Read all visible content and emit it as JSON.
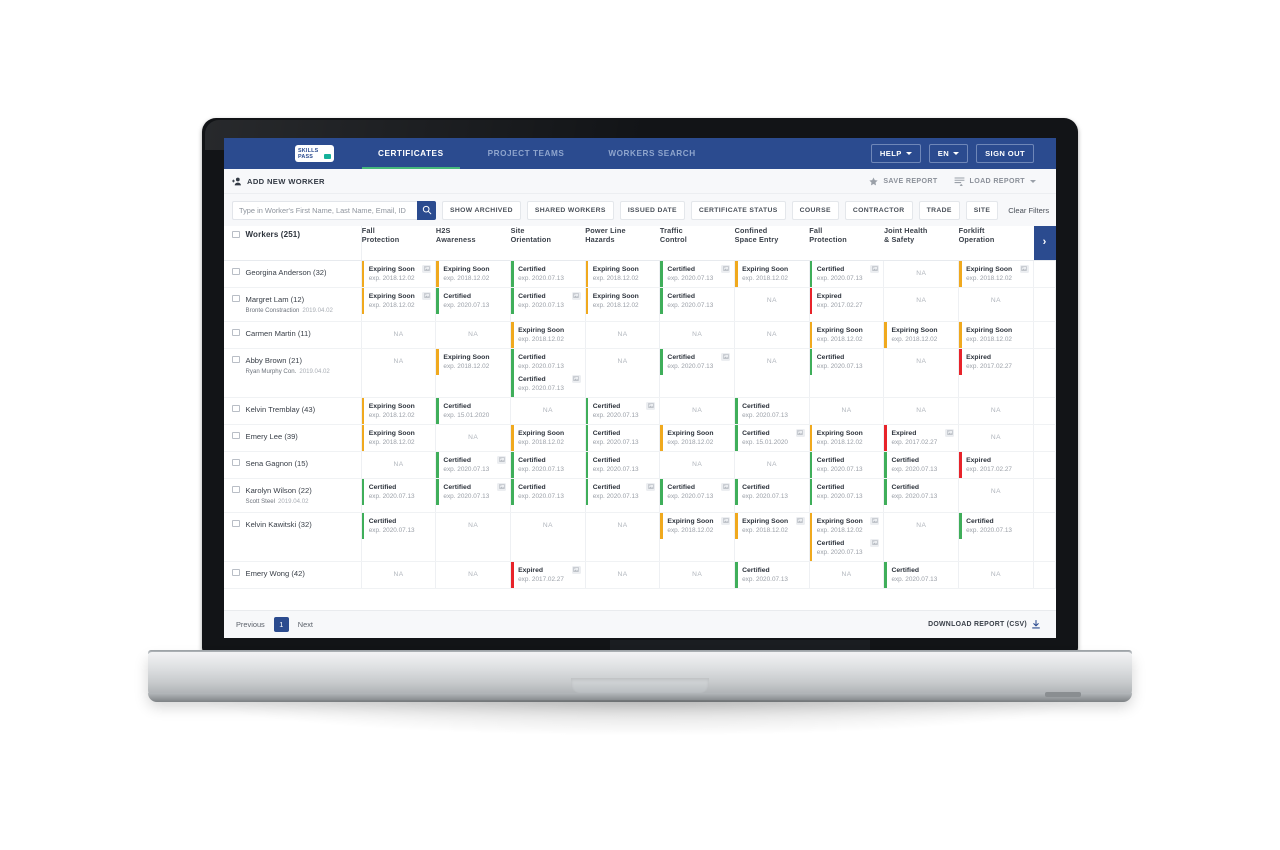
{
  "brand": {
    "logo_line1": "SKILLS",
    "logo_line2": "PASS",
    "accent_teal": "#16b19a",
    "nav_blue": "#2b4b8f",
    "tab_underline_green": "#46b97b"
  },
  "status_colors": {
    "certified": "#3fae5a",
    "expiring": "#f0a91e",
    "expired": "#e8232a",
    "na_text": "#b0b5bc"
  },
  "topnav": {
    "tabs": [
      {
        "label": "CERTIFICATES",
        "active": true
      },
      {
        "label": "PROJECT TEAMS",
        "active": false
      },
      {
        "label": "WORKERS SEARCH",
        "active": false
      }
    ],
    "help_label": "HELP",
    "lang_label": "EN",
    "signout_label": "SIGN OUT"
  },
  "actionbar": {
    "add_worker_label": "ADD NEW WORKER",
    "save_report_label": "SAVE REPORT",
    "load_report_label": "LOAD REPORT"
  },
  "filterbar": {
    "search_placeholder": "Type in Worker's First Name, Last Name, Email, ID",
    "search_value": "",
    "chips": [
      "SHOW ARCHIVED",
      "SHARED WORKERS",
      "ISSUED DATE",
      "CERTIFICATE STATUS",
      "COURSE",
      "CONTRACTOR",
      "TRADE",
      "SITE"
    ],
    "clear_filters_label": "Clear Filters"
  },
  "table": {
    "workers_header": "Workers (251)",
    "next_page_arrow": "›",
    "columns": [
      "Fall\nProtection",
      "H2S\nAwareness",
      "Site\nOrientation",
      "Power Line\nHazards",
      "Traffic\nControl",
      "Confined\nSpace Entry",
      "Fall\nProtection",
      "Joint Health\n& Safety",
      "Forklift\nOperation"
    ],
    "column_lines": [
      [
        "Fall",
        "Protection"
      ],
      [
        "H2S",
        "Awareness"
      ],
      [
        "Site",
        "Orientation"
      ],
      [
        "Power Line",
        "Hazards"
      ],
      [
        "Traffic",
        "Control"
      ],
      [
        "Confined",
        "Space Entry"
      ],
      [
        "Fall",
        "Protection"
      ],
      [
        "Joint Health",
        "& Safety"
      ],
      [
        "Forklift",
        "Operation"
      ]
    ],
    "na_label": "NA",
    "exp_prefix": "exp.",
    "rows": [
      {
        "name": "Georgina Anderson (32)",
        "company": "",
        "date": "",
        "cells": [
          {
            "entries": [
              {
                "status": "Expiring Soon",
                "type": "expiring",
                "exp": "exp. 2018.12.02",
                "photo": true
              }
            ]
          },
          {
            "entries": [
              {
                "status": "Expiring Soon",
                "type": "expiring",
                "exp": "exp. 2018.12.02",
                "photo": false
              }
            ]
          },
          {
            "entries": [
              {
                "status": "Certified",
                "type": "certified",
                "exp": "exp. 2020.07.13",
                "photo": false
              }
            ]
          },
          {
            "entries": [
              {
                "status": "Expiring Soon",
                "type": "expiring",
                "exp": "exp. 2018.12.02",
                "photo": false
              }
            ]
          },
          {
            "entries": [
              {
                "status": "Certified",
                "type": "certified",
                "exp": "exp. 2020.07.13",
                "photo": true
              }
            ]
          },
          {
            "entries": [
              {
                "status": "Expiring Soon",
                "type": "expiring",
                "exp": "exp. 2018.12.02",
                "photo": false
              }
            ]
          },
          {
            "entries": [
              {
                "status": "Certified",
                "type": "certified",
                "exp": "exp. 2020.07.13",
                "photo": true
              }
            ]
          },
          {
            "entries": []
          },
          {
            "entries": [
              {
                "status": "Expiring Soon",
                "type": "expiring",
                "exp": "exp. 2018.12.02",
                "photo": true
              }
            ]
          }
        ]
      },
      {
        "name": "Margret Lam (12)",
        "company": "Bronte Constraction",
        "date": "2019.04.02",
        "cells": [
          {
            "entries": [
              {
                "status": "Expiring Soon",
                "type": "expiring",
                "exp": "exp. 2018.12.02",
                "photo": true
              }
            ]
          },
          {
            "entries": [
              {
                "status": "Certified",
                "type": "certified",
                "exp": "exp. 2020.07.13",
                "photo": false
              }
            ]
          },
          {
            "entries": [
              {
                "status": "Certified",
                "type": "certified",
                "exp": "exp. 2020.07.13",
                "photo": true
              }
            ]
          },
          {
            "entries": [
              {
                "status": "Expiring Soon",
                "type": "expiring",
                "exp": "exp. 2018.12.02",
                "photo": false
              }
            ]
          },
          {
            "entries": [
              {
                "status": "Certified",
                "type": "certified",
                "exp": "exp. 2020.07.13",
                "photo": false
              }
            ]
          },
          {
            "entries": []
          },
          {
            "entries": [
              {
                "status": "Expired",
                "type": "expired",
                "exp": "exp. 2017.02.27",
                "photo": false
              }
            ]
          },
          {
            "entries": []
          },
          {
            "entries": []
          }
        ]
      },
      {
        "name": "Carmen Martin (11)",
        "company": "",
        "date": "",
        "cells": [
          {
            "entries": []
          },
          {
            "entries": []
          },
          {
            "entries": [
              {
                "status": "Expiring Soon",
                "type": "expiring",
                "exp": "exp. 2018.12.02",
                "photo": false
              }
            ]
          },
          {
            "entries": []
          },
          {
            "entries": []
          },
          {
            "entries": []
          },
          {
            "entries": [
              {
                "status": "Expiring Soon",
                "type": "expiring",
                "exp": "exp. 2018.12.02",
                "photo": false
              }
            ]
          },
          {
            "entries": [
              {
                "status": "Expiring Soon",
                "type": "expiring",
                "exp": "exp. 2018.12.02",
                "photo": false
              }
            ]
          },
          {
            "entries": [
              {
                "status": "Expiring Soon",
                "type": "expiring",
                "exp": "exp. 2018.12.02",
                "photo": false
              }
            ]
          }
        ]
      },
      {
        "name": "Abby Brown (21)",
        "company": "Ryan Murphy Con.",
        "date": "2019.04.02",
        "cells": [
          {
            "entries": []
          },
          {
            "entries": [
              {
                "status": "Expiring Soon",
                "type": "expiring",
                "exp": "exp. 2018.12.02",
                "photo": false
              }
            ]
          },
          {
            "entries": [
              {
                "status": "Certified",
                "type": "certified",
                "exp": "exp. 2020.07.13",
                "photo": false
              },
              {
                "status": "Certified",
                "type": "certified",
                "exp": "exp. 2020.07.13",
                "photo": true
              }
            ]
          },
          {
            "entries": []
          },
          {
            "entries": [
              {
                "status": "Certified",
                "type": "certified",
                "exp": "exp. 2020.07.13",
                "photo": true
              }
            ]
          },
          {
            "entries": []
          },
          {
            "entries": [
              {
                "status": "Certified",
                "type": "certified",
                "exp": "exp. 2020.07.13",
                "photo": false
              }
            ]
          },
          {
            "entries": []
          },
          {
            "entries": [
              {
                "status": "Expired",
                "type": "expired",
                "exp": "exp. 2017.02.27",
                "photo": false
              }
            ]
          }
        ]
      },
      {
        "name": "Kelvin Tremblay (43)",
        "company": "",
        "date": "",
        "cells": [
          {
            "entries": [
              {
                "status": "Expiring Soon",
                "type": "expiring",
                "exp": "exp. 2018.12.02",
                "photo": false
              }
            ]
          },
          {
            "entries": [
              {
                "status": "Certified",
                "type": "certified",
                "exp": "exp. 15.01.2020",
                "photo": false
              }
            ]
          },
          {
            "entries": []
          },
          {
            "entries": [
              {
                "status": "Certified",
                "type": "certified",
                "exp": "exp. 2020.07.13",
                "photo": true
              }
            ]
          },
          {
            "entries": []
          },
          {
            "entries": [
              {
                "status": "Certified",
                "type": "certified",
                "exp": "exp. 2020.07.13",
                "photo": false
              }
            ]
          },
          {
            "entries": []
          },
          {
            "entries": []
          },
          {
            "entries": []
          }
        ]
      },
      {
        "name": "Emery Lee (39)",
        "company": "",
        "date": "",
        "cells": [
          {
            "entries": [
              {
                "status": "Expiring Soon",
                "type": "expiring",
                "exp": "exp. 2018.12.02",
                "photo": false
              }
            ]
          },
          {
            "entries": []
          },
          {
            "entries": [
              {
                "status": "Expiring Soon",
                "type": "expiring",
                "exp": "exp. 2018.12.02",
                "photo": false
              }
            ]
          },
          {
            "entries": [
              {
                "status": "Certified",
                "type": "certified",
                "exp": "exp. 2020.07.13",
                "photo": false
              }
            ]
          },
          {
            "entries": [
              {
                "status": "Expiring Soon",
                "type": "expiring",
                "exp": "exp. 2018.12.02",
                "photo": false
              }
            ]
          },
          {
            "entries": [
              {
                "status": "Certified",
                "type": "certified",
                "exp": "exp. 15.01.2020",
                "photo": true
              }
            ]
          },
          {
            "entries": [
              {
                "status": "Expiring Soon",
                "type": "expiring",
                "exp": "exp. 2018.12.02",
                "photo": false
              }
            ]
          },
          {
            "entries": [
              {
                "status": "Expired",
                "type": "expired",
                "exp": "exp. 2017.02.27",
                "photo": true
              }
            ]
          },
          {
            "entries": []
          }
        ]
      },
      {
        "name": "Sena Gagnon (15)",
        "company": "",
        "date": "",
        "cells": [
          {
            "entries": []
          },
          {
            "entries": [
              {
                "status": "Certified",
                "type": "certified",
                "exp": "exp. 2020.07.13",
                "photo": true
              }
            ]
          },
          {
            "entries": [
              {
                "status": "Certified",
                "type": "certified",
                "exp": "exp. 2020.07.13",
                "photo": false
              }
            ]
          },
          {
            "entries": [
              {
                "status": "Certified",
                "type": "certified",
                "exp": "exp. 2020.07.13",
                "photo": false
              }
            ]
          },
          {
            "entries": []
          },
          {
            "entries": []
          },
          {
            "entries": [
              {
                "status": "Certified",
                "type": "certified",
                "exp": "exp. 2020.07.13",
                "photo": false
              }
            ]
          },
          {
            "entries": [
              {
                "status": "Certified",
                "type": "certified",
                "exp": "exp. 2020.07.13",
                "photo": false
              }
            ]
          },
          {
            "entries": [
              {
                "status": "Expired",
                "type": "expired",
                "exp": "exp. 2017.02.27",
                "photo": false
              }
            ]
          }
        ]
      },
      {
        "name": "Karolyn Wilson (22)",
        "company": "Scott Steel",
        "date": "2019.04.02",
        "cells": [
          {
            "entries": [
              {
                "status": "Certified",
                "type": "certified",
                "exp": "exp. 2020.07.13",
                "photo": false
              }
            ]
          },
          {
            "entries": [
              {
                "status": "Certified",
                "type": "certified",
                "exp": "exp. 2020.07.13",
                "photo": true
              }
            ]
          },
          {
            "entries": [
              {
                "status": "Certified",
                "type": "certified",
                "exp": "exp. 2020.07.13",
                "photo": false
              }
            ]
          },
          {
            "entries": [
              {
                "status": "Certified",
                "type": "certified",
                "exp": "exp. 2020.07.13",
                "photo": true
              }
            ]
          },
          {
            "entries": [
              {
                "status": "Certified",
                "type": "certified",
                "exp": "exp. 2020.07.13",
                "photo": true
              }
            ]
          },
          {
            "entries": [
              {
                "status": "Certified",
                "type": "certified",
                "exp": "exp. 2020.07.13",
                "photo": false
              }
            ]
          },
          {
            "entries": [
              {
                "status": "Certified",
                "type": "certified",
                "exp": "exp. 2020.07.13",
                "photo": false
              }
            ]
          },
          {
            "entries": [
              {
                "status": "Certified",
                "type": "certified",
                "exp": "exp. 2020.07.13",
                "photo": false
              }
            ]
          },
          {
            "entries": []
          }
        ]
      },
      {
        "name": "Kelvin Kawitski (32)",
        "company": "",
        "date": "",
        "cells": [
          {
            "entries": [
              {
                "status": "Certified",
                "type": "certified",
                "exp": "exp. 2020.07.13",
                "photo": false
              }
            ]
          },
          {
            "entries": []
          },
          {
            "entries": []
          },
          {
            "entries": []
          },
          {
            "entries": [
              {
                "status": "Expiring Soon",
                "type": "expiring",
                "exp": "exp. 2018.12.02",
                "photo": true
              }
            ]
          },
          {
            "entries": [
              {
                "status": "Expiring Soon",
                "type": "expiring",
                "exp": "exp. 2018.12.02",
                "photo": true
              }
            ]
          },
          {
            "entries": [
              {
                "status": "Expiring Soon",
                "type": "expiring",
                "exp": "exp. 2018.12.02",
                "photo": true
              },
              {
                "status": "Certified",
                "type": "certified",
                "exp": "exp. 2020.07.13",
                "photo": true
              }
            ]
          },
          {
            "entries": []
          },
          {
            "entries": [
              {
                "status": "Certified",
                "type": "certified",
                "exp": "exp. 2020.07.13",
                "photo": false
              }
            ]
          }
        ]
      },
      {
        "name": "Emery Wong (42)",
        "company": "",
        "date": "",
        "cells": [
          {
            "entries": []
          },
          {
            "entries": []
          },
          {
            "entries": [
              {
                "status": "Expired",
                "type": "expired",
                "exp": "exp. 2017.02.27",
                "photo": true
              }
            ]
          },
          {
            "entries": []
          },
          {
            "entries": []
          },
          {
            "entries": [
              {
                "status": "Certified",
                "type": "certified",
                "exp": "exp. 2020.07.13",
                "photo": false
              }
            ]
          },
          {
            "entries": []
          },
          {
            "entries": [
              {
                "status": "Certified",
                "type": "certified",
                "exp": "exp. 2020.07.13",
                "photo": false
              }
            ]
          },
          {
            "entries": []
          }
        ]
      }
    ]
  },
  "footer": {
    "previous_label": "Previous",
    "page_number": "1",
    "next_label": "Next",
    "download_label": "DOWNLOAD REPORT (CSV)"
  },
  "icons": {
    "add_worker": "add-person-icon",
    "save_report": "star-icon",
    "load_report": "list-icon",
    "search": "search-icon",
    "download": "download-icon",
    "photo": "photo-icon",
    "next_page": "chevron-right-icon",
    "caret": "chevron-down-icon"
  }
}
